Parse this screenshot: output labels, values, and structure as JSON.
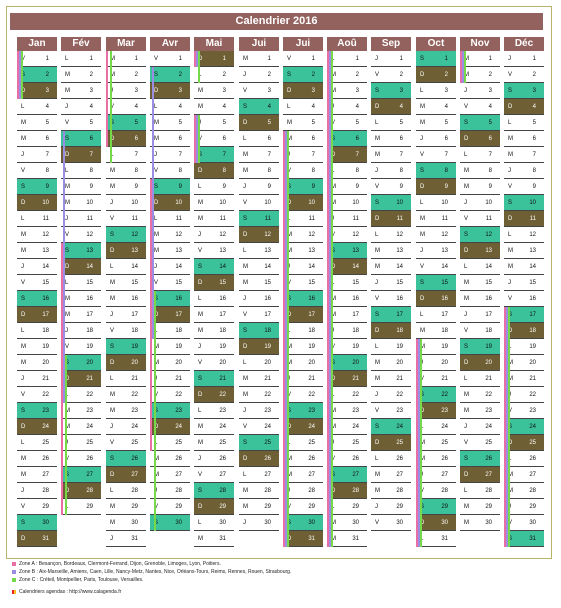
{
  "title": "Calendrier 2016",
  "colors": {
    "zoneA": "#e86fa5",
    "zoneB": "#9a8ee2",
    "zoneC": "#76d94a"
  },
  "months": [
    {
      "name": "Jan",
      "first_wd": 4,
      "len": 31
    },
    {
      "name": "Fév",
      "first_wd": 0,
      "len": 29
    },
    {
      "name": "Mar",
      "first_wd": 1,
      "len": 31
    },
    {
      "name": "Avr",
      "first_wd": 4,
      "len": 30
    },
    {
      "name": "Mai",
      "first_wd": 6,
      "len": 31
    },
    {
      "name": "Jui",
      "first_wd": 2,
      "len": 30
    },
    {
      "name": "Jui",
      "first_wd": 4,
      "len": 31
    },
    {
      "name": "Aoû",
      "first_wd": 0,
      "len": 31
    },
    {
      "name": "Sep",
      "first_wd": 3,
      "len": 30
    },
    {
      "name": "Oct",
      "first_wd": 5,
      "len": 31
    },
    {
      "name": "Nov",
      "first_wd": 1,
      "len": 30
    },
    {
      "name": "Déc",
      "first_wd": 3,
      "len": 31
    }
  ],
  "weekday_letters": [
    "L",
    "M",
    "M",
    "J",
    "V",
    "S",
    "D"
  ],
  "vacations": [
    {
      "zone": "zoneA",
      "m": 0,
      "a": 1,
      "b": 3
    },
    {
      "zone": "zoneB",
      "m": 0,
      "a": 1,
      "b": 3
    },
    {
      "zone": "zoneC",
      "m": 0,
      "a": 1,
      "b": 3
    },
    {
      "zone": "zoneB",
      "m": 1,
      "a": 6,
      "b": 22
    },
    {
      "zone": "zoneA",
      "m": 1,
      "a": 13,
      "b": 29
    },
    {
      "zone": "zoneC",
      "m": 1,
      "a": 20,
      "b": 31
    },
    {
      "zone": "zoneA",
      "m": 2,
      "a": 1,
      "b": 6
    },
    {
      "zone": "zoneC",
      "m": 2,
      "a": 1,
      "b": 7
    },
    {
      "zone": "zoneB",
      "m": 3,
      "a": 2,
      "b": 18
    },
    {
      "zone": "zoneA",
      "m": 3,
      "a": 9,
      "b": 25
    },
    {
      "zone": "zoneC",
      "m": 3,
      "a": 16,
      "b": 31
    },
    {
      "zone": "zoneA",
      "m": 4,
      "a": 1,
      "b": 1
    },
    {
      "zone": "zoneB",
      "m": 4,
      "a": 1,
      "b": 1
    },
    {
      "zone": "zoneC",
      "m": 4,
      "a": 1,
      "b": 2
    },
    {
      "zone": "zoneA",
      "m": 4,
      "a": 5,
      "b": 7
    },
    {
      "zone": "zoneB",
      "m": 4,
      "a": 5,
      "b": 7
    },
    {
      "zone": "zoneC",
      "m": 4,
      "a": 5,
      "b": 7
    },
    {
      "zone": "zoneA",
      "m": 6,
      "a": 6,
      "b": 31
    },
    {
      "zone": "zoneB",
      "m": 6,
      "a": 6,
      "b": 31
    },
    {
      "zone": "zoneC",
      "m": 6,
      "a": 6,
      "b": 31
    },
    {
      "zone": "zoneA",
      "m": 7,
      "a": 1,
      "b": 31
    },
    {
      "zone": "zoneB",
      "m": 7,
      "a": 1,
      "b": 31
    },
    {
      "zone": "zoneC",
      "m": 7,
      "a": 1,
      "b": 31
    },
    {
      "zone": "zoneA",
      "m": 9,
      "a": 19,
      "b": 31
    },
    {
      "zone": "zoneB",
      "m": 9,
      "a": 19,
      "b": 31
    },
    {
      "zone": "zoneC",
      "m": 9,
      "a": 19,
      "b": 31
    },
    {
      "zone": "zoneA",
      "m": 10,
      "a": 1,
      "b": 2
    },
    {
      "zone": "zoneB",
      "m": 10,
      "a": 1,
      "b": 2
    },
    {
      "zone": "zoneC",
      "m": 10,
      "a": 1,
      "b": 2
    },
    {
      "zone": "zoneA",
      "m": 11,
      "a": 17,
      "b": 31
    },
    {
      "zone": "zoneB",
      "m": 11,
      "a": 17,
      "b": 31
    },
    {
      "zone": "zoneC",
      "m": 11,
      "a": 17,
      "b": 31
    }
  ],
  "legend": {
    "zoneA": "Zone A : Besançon, Bordeaux, Clermont-Ferrand, Dijon, Grenoble, Limoges, Lyon, Poitiers.",
    "zoneB": "Zone B : Aix-Marseille, Amiens, Caen, Lille, Nancy-Metz, Nantes, Nice, Orléans-Tours, Reims, Rennes, Rouen, Strasbourg.",
    "zoneC": "Zone C : Créteil, Montpellier, Paris, Toulouse, Versailles.",
    "footer": "Calendriers agendas : http://www.calagenda.fr"
  }
}
